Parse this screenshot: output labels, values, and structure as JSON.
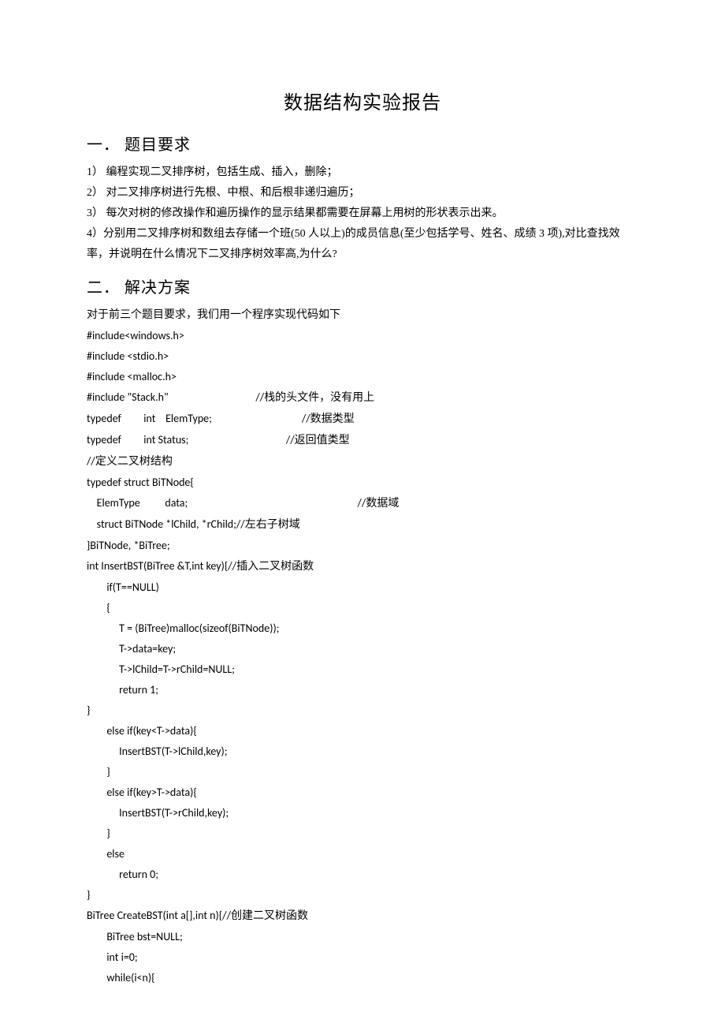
{
  "title": "数据结构实验报告",
  "section1": {
    "heading": "一． 题目要求",
    "items": [
      "1） 编程实现二叉排序树，包括生成、插入，删除；",
      "2） 对二叉排序树进行先根、中根、和后根非递归遍历；",
      "3） 每次对树的修改操作和遍历操作的显示结果都需要在屏幕上用树的形状表示出来。",
      "4）分别用二叉排序树和数组去存储一个班(50 人以上)的成员信息(至少包括学号、姓名、成绩 3 项),对比查找效率，并说明在什么情况下二叉排序树效率高,为什么?"
    ]
  },
  "section2": {
    "heading": "二． 解决方案",
    "intro": "对于前三个题目要求，我们用一个程序实现代码如下",
    "code": [
      "#include<windows.h>",
      "#include <stdio.h>",
      "#include <malloc.h>",
      {
        "text": "#include \"Stack.h\"",
        "pad": "                                   ",
        "comment": "//栈的头文件，没有用上"
      },
      {
        "text": "typedef         int    ElemType;",
        "pad": "                                    ",
        "comment": "//数据类型"
      },
      {
        "text": "typedef         int Status;",
        "pad": "                                       ",
        "comment": "//返回值类型"
      },
      "//定义二叉树结构",
      "typedef struct BiTNode{",
      {
        "text": "    ElemType          data;",
        "pad": "                                                                    ",
        "comment": "//数据域"
      },
      "    struct BiTNode *lChild, *rChild;//左右子树域",
      "}BiTNode, *BiTree;",
      "int InsertBST(BiTree &T,int key){//插入二叉树函数",
      "        if(T==NULL)",
      "        {",
      "             T = (BiTree)malloc(sizeof(BiTNode));",
      "             T->data=key;",
      "             T->lChild=T->rChild=NULL;",
      "             return 1;",
      "}",
      "        else if(key<T->data){",
      "             InsertBST(T->lChild,key);",
      "        }",
      "        else if(key>T->data){",
      "             InsertBST(T->rChild,key);",
      "        }",
      "        else",
      "             return 0;",
      "}",
      "BiTree CreateBST(int a[],int n){//创建二叉树函数",
      "        BiTree bst=NULL;",
      "        int i=0;",
      "        while(i<n){"
    ]
  }
}
